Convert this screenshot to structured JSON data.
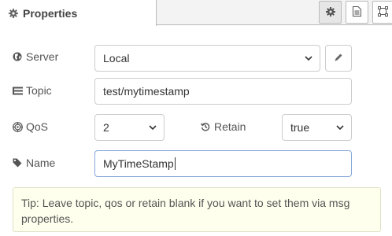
{
  "tabs": {
    "active_label": "Properties"
  },
  "form": {
    "server": {
      "label": "Server",
      "value": "Local"
    },
    "topic": {
      "label": "Topic",
      "value": "test/mytimestamp"
    },
    "qos": {
      "label": "QoS",
      "value": "2"
    },
    "retain": {
      "label": "Retain",
      "value": "true"
    },
    "name": {
      "label": "Name",
      "value": "MyTimeStamp"
    }
  },
  "tip": "Tip: Leave topic, qos or retain blank if you want to set them via msg properties.",
  "icons": {
    "tab": "gear-icon",
    "toolbar": [
      "gear-icon",
      "document-icon",
      "frame-icon"
    ],
    "server": "globe-icon",
    "topic": "list-icon",
    "qos": "empire-icon",
    "retain": "history-icon",
    "name": "tag-icon",
    "edit": "pencil-icon"
  }
}
